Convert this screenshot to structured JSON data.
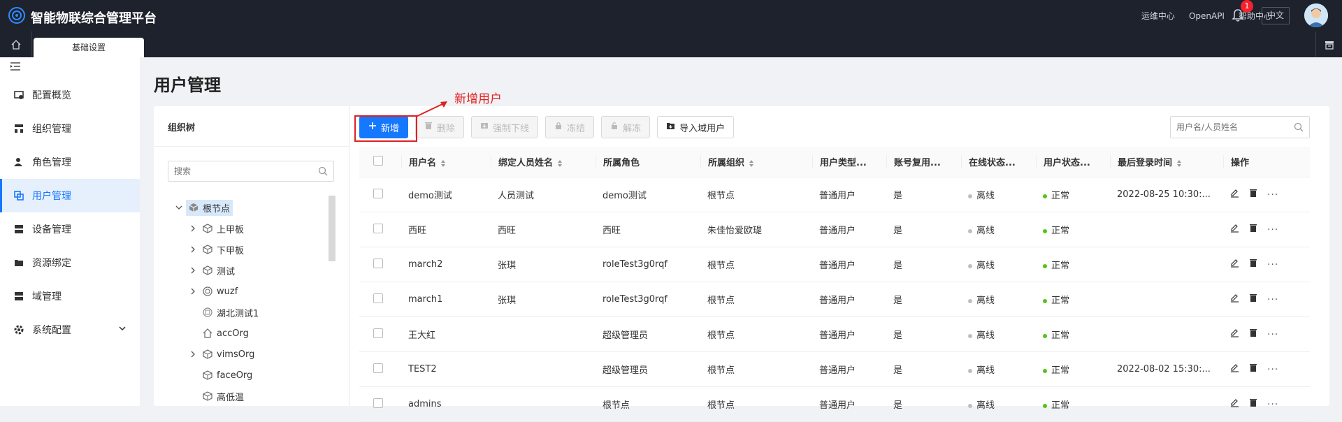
{
  "header": {
    "app_title": "智能物联综合管理平台",
    "links": [
      "运维中心",
      "OpenAPI",
      "帮助中心"
    ],
    "notification_count": "1",
    "language": "中文"
  },
  "tabs": {
    "active": "基础设置"
  },
  "sidebar": {
    "items": [
      {
        "label": "配置概览",
        "icon": "overview-icon"
      },
      {
        "label": "组织管理",
        "icon": "org-icon"
      },
      {
        "label": "角色管理",
        "icon": "role-icon"
      },
      {
        "label": "用户管理",
        "icon": "user-icon",
        "active": true
      },
      {
        "label": "设备管理",
        "icon": "device-icon"
      },
      {
        "label": "资源绑定",
        "icon": "resource-icon"
      },
      {
        "label": "域管理",
        "icon": "domain-icon"
      },
      {
        "label": "系统配置",
        "icon": "settings-icon",
        "expandable": true
      }
    ]
  },
  "page": {
    "title": "用户管理"
  },
  "tree": {
    "title": "组织树",
    "search_placeholder": "搜索",
    "nodes": [
      {
        "label": "根节点",
        "level": 0,
        "expanded": true,
        "selected": true
      },
      {
        "label": "上甲板",
        "level": 1,
        "has_children": true
      },
      {
        "label": "下甲板",
        "level": 1,
        "has_children": true
      },
      {
        "label": "测试",
        "level": 1,
        "has_children": true
      },
      {
        "label": "wuzf",
        "level": 1,
        "has_children": true
      },
      {
        "label": "湖北测试1",
        "level": 1,
        "has_children": false
      },
      {
        "label": "accOrg",
        "level": 1,
        "has_children": false
      },
      {
        "label": "vimsOrg",
        "level": 1,
        "has_children": true
      },
      {
        "label": "faceOrg",
        "level": 1,
        "has_children": false
      },
      {
        "label": "高低温",
        "level": 1,
        "has_children": false
      }
    ]
  },
  "toolbar": {
    "add": "新增",
    "delete": "删除",
    "force_offline": "强制下线",
    "freeze": "冻结",
    "unfreeze": "解冻",
    "import_domain_user": "导入域用户",
    "search_placeholder": "用户名/人员姓名"
  },
  "annotation": {
    "label": "新增用户",
    "color": "#e02020"
  },
  "table": {
    "columns": [
      "用户名",
      "绑定人员姓名",
      "所属角色",
      "所属组织",
      "用户类型...",
      "账号复用...",
      "在线状态...",
      "用户状态...",
      "最后登录时间",
      "操作"
    ],
    "rows": [
      {
        "username": "demo测试",
        "person": "人员测试",
        "role": "demo测试",
        "org": "根节点",
        "type": "普通用户",
        "reuse": "是",
        "online": "离线",
        "status": "正常",
        "last_login": "2022-08-25 10:30:..."
      },
      {
        "username": "西旺",
        "person": "西旺",
        "role": "西旺",
        "org": "朱佳怡爱欧瑅",
        "type": "普通用户",
        "reuse": "是",
        "online": "离线",
        "status": "正常",
        "last_login": ""
      },
      {
        "username": "march2",
        "person": "张琪",
        "role": "roleTest3g0rqf",
        "org": "根节点",
        "type": "普通用户",
        "reuse": "是",
        "online": "离线",
        "status": "正常",
        "last_login": ""
      },
      {
        "username": "march1",
        "person": "张琪",
        "role": "roleTest3g0rqf",
        "org": "根节点",
        "type": "普通用户",
        "reuse": "是",
        "online": "离线",
        "status": "正常",
        "last_login": ""
      },
      {
        "username": "王大红",
        "person": "",
        "role": "超级管理员",
        "org": "根节点",
        "type": "普通用户",
        "reuse": "是",
        "online": "离线",
        "status": "正常",
        "last_login": ""
      },
      {
        "username": "TEST2",
        "person": "",
        "role": "超级管理员",
        "org": "根节点",
        "type": "普通用户",
        "reuse": "是",
        "online": "离线",
        "status": "正常",
        "last_login": "2022-08-02 15:30:..."
      },
      {
        "username": "admins",
        "person": "",
        "role": "根节点",
        "org": "根节点",
        "type": "普通用户",
        "reuse": "是",
        "online": "离线",
        "status": "正常",
        "last_login": ""
      }
    ]
  }
}
